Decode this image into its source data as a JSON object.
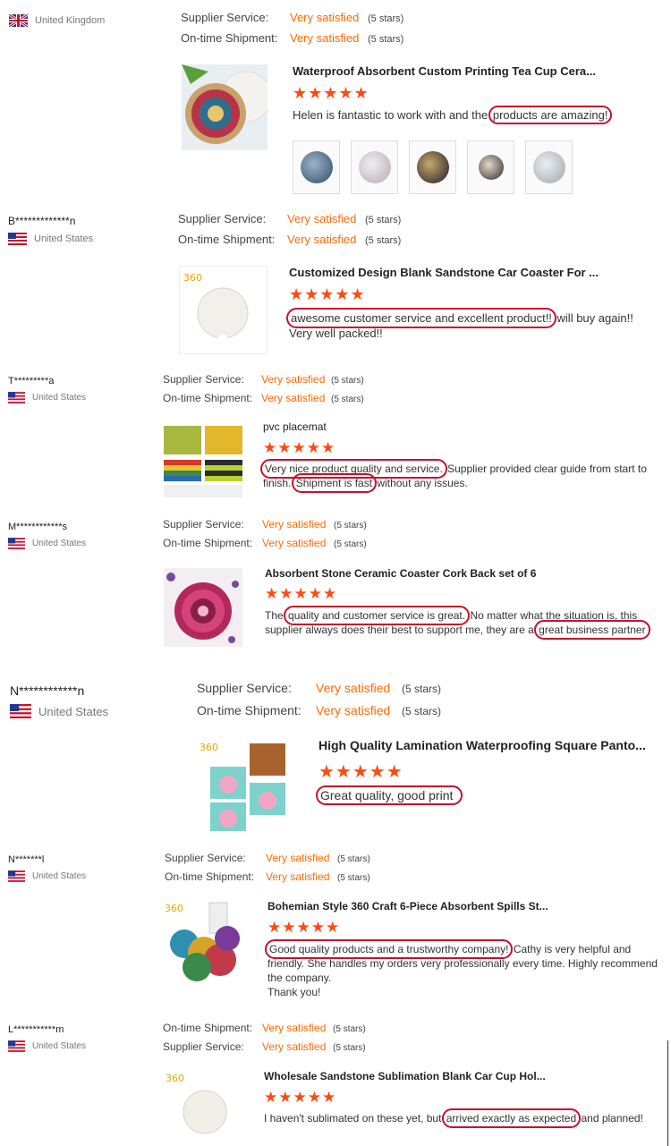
{
  "labels": {
    "supplier_service": "Supplier Service:",
    "ontime_shipment": "On-time Shipment:",
    "very_satisfied": "Very satisfied",
    "five_stars": "(5 stars)",
    "stars_glyphs": "★★★★★"
  },
  "reviews": [
    {
      "name": "",
      "country": "United Kingdom",
      "row1_label": "Supplier Service:",
      "row2_label": "On-time Shipment:",
      "product_title": "Waterproof Absorbent Custom Printing Tea Cup Cera...",
      "text_before": "Helen is fantastic to work with and the ",
      "text_highlight": "products are amazing!",
      "text_after": ""
    },
    {
      "name": "B*************n",
      "country": "United States",
      "row1_label": "Supplier Service:",
      "row2_label": "On-time Shipment:",
      "product_title": "Customized Design Blank Sandstone Car Coaster For ...",
      "text_before": "",
      "text_highlight": "awesome customer service and excellent product!!",
      "text_after": " will buy again!! Very well packed!!"
    },
    {
      "name": "T*********a",
      "country": "United States",
      "row1_label": "Supplier Service:",
      "row2_label": "On-time Shipment:",
      "product_title": "pvc placemat",
      "text_before": "",
      "text_highlight": "Very nice product quality and service.",
      "text_middle": " Supplier provided clear guide from start to finish. ",
      "text_highlight2": "Shipment is fast",
      "text_after": " without any issues."
    },
    {
      "name": "M************s",
      "country": "United States",
      "row1_label": "Supplier Service:",
      "row2_label": "On-time Shipment:",
      "product_title": "Absorbent Stone Ceramic Coaster Cork Back set of 6",
      "text_before": "The ",
      "text_highlight": "quality and customer service is great.",
      "text_middle": " No matter what the situation is, this supplier always does their best to support me, they are a ",
      "text_highlight2": "great business partner",
      "text_after": ""
    },
    {
      "name": "N************n",
      "country": "United States",
      "row1_label": "Supplier Service:",
      "row2_label": "On-time Shipment:",
      "product_title": "High Quality Lamination Waterproofing Square Panto...",
      "text_before": "",
      "text_highlight": "Great quality, good print",
      "text_after": ""
    },
    {
      "name": "N*******l",
      "country": "United States",
      "row1_label": "Supplier Service:",
      "row2_label": "On-time Shipment:",
      "product_title": "Bohemian Style 360 Craft 6-Piece Absorbent Spills St...",
      "text_before": "",
      "text_highlight": "Good quality products and a trustworthy company!",
      "text_after": " Cathy is very helpful and friendly. She handles my orders very professionally every time. Highly recommend the company.",
      "text_extra": "Thank you!"
    },
    {
      "name": "L***********m",
      "country": "United States",
      "row1_label": "On-time Shipment:",
      "row2_label": "Supplier Service:",
      "product_title": "Wholesale Sandstone Sublimation Blank Car Cup Hol...",
      "text_before": "I haven't sublimated on these yet, but ",
      "text_highlight": "arrived exactly as expected",
      "text_after": " and planned!"
    }
  ],
  "colors": {
    "accent_orange": "#ff6a00",
    "star_red": "#ff4a12",
    "highlight_ring": "#c8102e"
  },
  "icons": [
    "uk-flag-icon",
    "us-flag-icon",
    "star-icon"
  ]
}
